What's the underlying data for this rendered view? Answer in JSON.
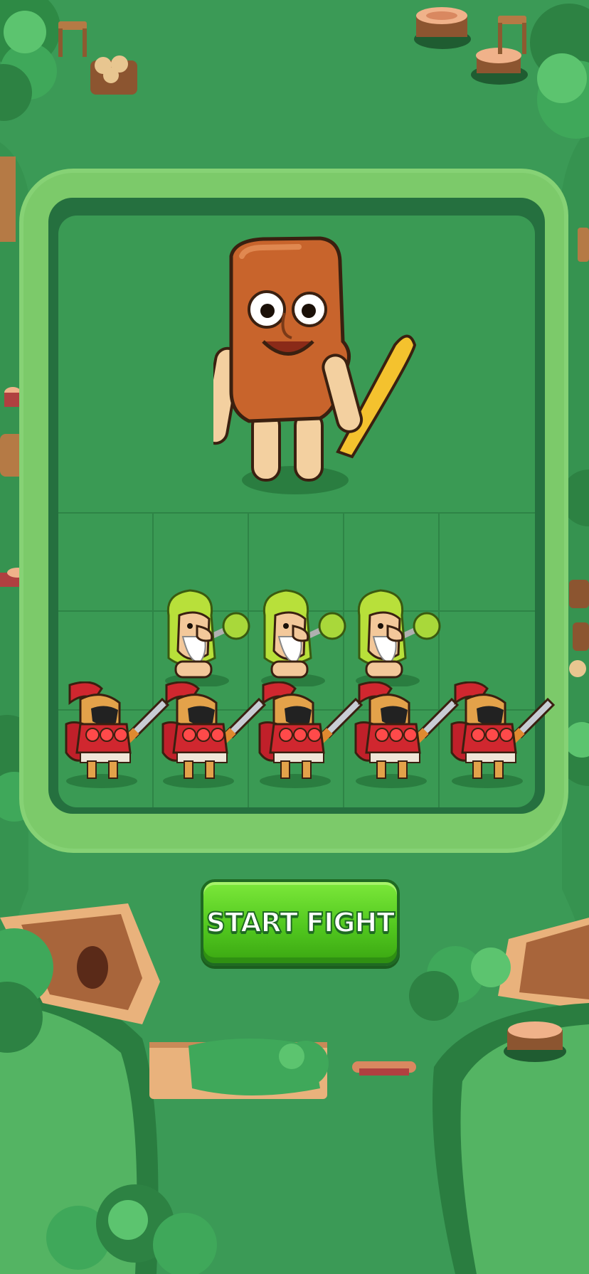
{
  "screen": "battle-setup",
  "buttons": {
    "start_fight": "START FIGHT"
  },
  "board": {
    "columns": 5,
    "rows": 3
  },
  "enemy": {
    "name": "wooden-club-creature"
  },
  "player_units": {
    "row_middle": [
      "leaf-hermit",
      "leaf-hermit",
      "leaf-hermit"
    ],
    "row_bottom": [
      "spartan",
      "spartan",
      "spartan",
      "spartan",
      "spartan"
    ]
  },
  "colors": {
    "background": "#3a9a55",
    "board_frame": "#25703f",
    "board_field": "#3a9a54",
    "button_green": "#52c81f",
    "enemy_wood": "#c8642c",
    "spartan_red": "#d0272f",
    "hermit_leaf": "#b8e03a"
  }
}
